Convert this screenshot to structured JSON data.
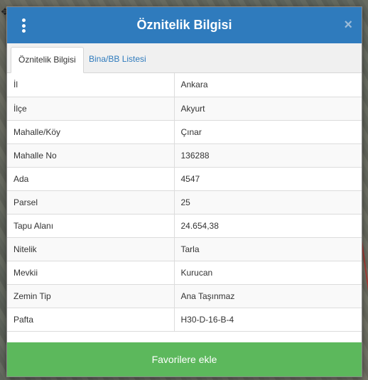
{
  "dialog": {
    "title": "Öznitelik Bilgisi",
    "close_glyph": "×",
    "menu_icon": "vertical-dots-icon"
  },
  "tabs": [
    {
      "label": "Öznitelik Bilgisi",
      "active": true
    },
    {
      "label": "Bina/BB Listesi",
      "active": false
    }
  ],
  "attributes": [
    {
      "key": "İl",
      "value": "Ankara"
    },
    {
      "key": "İlçe",
      "value": "Akyurt"
    },
    {
      "key": "Mahalle/Köy",
      "value": "Çınar"
    },
    {
      "key": "Mahalle No",
      "value": "136288"
    },
    {
      "key": "Ada",
      "value": "4547"
    },
    {
      "key": "Parsel",
      "value": "25"
    },
    {
      "key": "Tapu Alanı",
      "value": "24.654,38"
    },
    {
      "key": "Nitelik",
      "value": "Tarla"
    },
    {
      "key": "Mevkii",
      "value": "Kurucan"
    },
    {
      "key": "Zemin Tip",
      "value": "Ana Taşınmaz"
    },
    {
      "key": "Pafta",
      "value": "H30-D-16-B-4"
    }
  ],
  "favorite_button": {
    "label": "Favorilere ekle"
  },
  "colors": {
    "header": "#2f7bbd",
    "button": "#5cb85c",
    "tab_link": "#2f7bbd"
  }
}
